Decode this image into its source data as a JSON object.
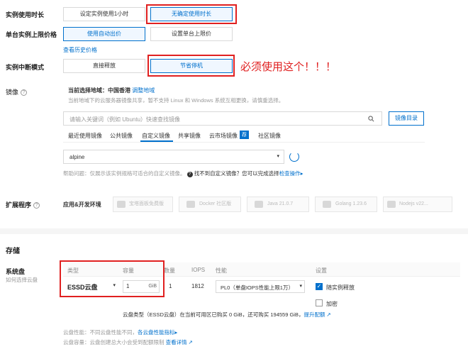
{
  "duration": {
    "label": "实例使用时长",
    "options": [
      "设定实例使用1小时",
      "无确定使用时长"
    ],
    "selected": 1
  },
  "price_limit": {
    "label": "单台实例上限价格",
    "options": [
      "使用自动出价",
      "设置单台上限价"
    ],
    "selected": 0,
    "history_link": "查看历史价格"
  },
  "interrupt": {
    "label": "实例中断模式",
    "options": [
      "直接释放",
      "节省停机"
    ],
    "selected": 1,
    "annotation": "必须使用这个！！！"
  },
  "image": {
    "label": "镜像",
    "region_prefix": "当前选择地域：中国香港",
    "region_link": "调整地域",
    "note": "当前地域下的云服务器镜像共享，暂不支持 Linux 和 Windows 系统互相更换，请慎重选择。",
    "search_placeholder": "请输入关键词（例如 Ubuntu）快速查找镜像",
    "search_button": "镜像目录",
    "tabs": [
      "最近使用镜像",
      "公共镜像",
      "自定义镜像",
      "共享镜像",
      "云市场镜像",
      "荐",
      "社区镜像"
    ],
    "active_tab": 2,
    "selected_image": "alpine",
    "help_text": "帮助问题：仅展示该实例规格可适合的自定义镜像。",
    "help_question": "找不到自定义镜像？您可以完成选择",
    "help_link": "检查操作"
  },
  "extensions": {
    "label": "扩展程序",
    "category": "应用&开发环境",
    "items": [
      "宝塔面板免费版",
      "Docker 社区版",
      "Java 21.0.7",
      "Golang 1.23.6",
      "Nodejs v22..."
    ]
  },
  "storage": {
    "section_title": "存储",
    "system_disk_label": "系统盘",
    "system_disk_sub": "如何选择云盘",
    "headers": [
      "类型",
      "容量",
      "数量",
      "IOPS",
      "性能",
      "设置"
    ],
    "disk_type": "ESSD云盘",
    "capacity": "1",
    "unit": "GiB",
    "count": "1",
    "iops": "1812",
    "performance": "PL0（单盘IOPS性能上限1万）",
    "release_with_instance": "随实例释放",
    "encrypt": "加密",
    "quota_text": "云盘类型（ESSD云盘）在当前可用区已购买 0 GiB，还可购买 194559 GiB，",
    "quota_link": "提升配额",
    "perf_note": "云盘性能：不同云盘性能不同，",
    "perf_link": "各云盘性能指标",
    "capacity_note": "云盘容量：云盘创建总大小会受到配额限制",
    "capacity_link": "查看详情"
  }
}
